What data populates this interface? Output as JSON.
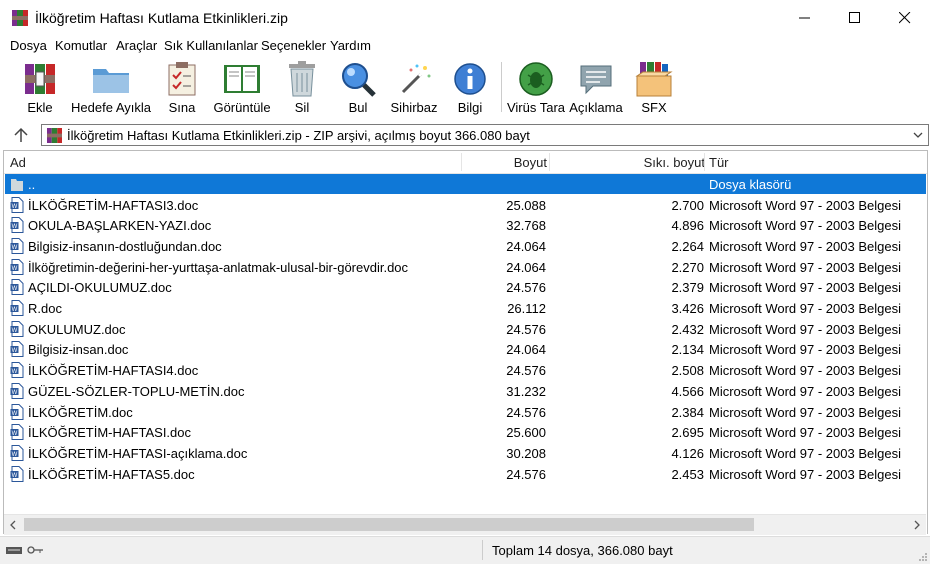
{
  "window": {
    "title": "İlköğretim Haftası Kutlama Etkinlikleri.zip",
    "minimize_glyph": "—",
    "maximize_glyph": "☐",
    "close_glyph": "✕"
  },
  "menu": [
    "Dosya",
    "Komutlar",
    "Araçlar",
    "Sık Kullanılanlar",
    "Seçenekler",
    "Yardım"
  ],
  "toolbar": [
    {
      "label": "Ekle",
      "icon": "books-add-icon"
    },
    {
      "label": "Hedefe Ayıkla",
      "icon": "folder-extract-icon"
    },
    {
      "label": "Sına",
      "icon": "test-checklist-icon"
    },
    {
      "label": "Görüntüle",
      "icon": "book-view-icon"
    },
    {
      "label": "Sil",
      "icon": "trash-icon"
    },
    {
      "label": "Bul",
      "icon": "magnifier-icon"
    },
    {
      "label": "Sihirbaz",
      "icon": "wizard-wand-icon"
    },
    {
      "label": "Bilgi",
      "icon": "info-icon"
    },
    {
      "label": "Virüs Tara",
      "icon": "virus-scan-icon"
    },
    {
      "label": "Açıklama",
      "icon": "comment-icon"
    },
    {
      "label": "SFX",
      "icon": "sfx-box-icon"
    }
  ],
  "address": {
    "text": "İlköğretim Haftası Kutlama Etkinlikleri.zip - ZIP arşivi, açılmış boyut 366.080 bayt"
  },
  "columns": {
    "name": "Ad",
    "size": "Boyut",
    "packed": "Sıkı. boyut",
    "type": "Tür"
  },
  "parent_row": {
    "name": "..",
    "type": "Dosya klasörü"
  },
  "files": [
    {
      "name": "İLKÖĞRETİM-HAFTASI3.doc",
      "size": "25.088",
      "packed": "2.700",
      "type": "Microsoft Word 97 - 2003 Belgesi"
    },
    {
      "name": "OKULA-BAŞLARKEN-YAZI.doc",
      "size": "32.768",
      "packed": "4.896",
      "type": "Microsoft Word 97 - 2003 Belgesi"
    },
    {
      "name": "Bilgisiz-insanın-dostluğundan.doc",
      "size": "24.064",
      "packed": "2.264",
      "type": "Microsoft Word 97 - 2003 Belgesi"
    },
    {
      "name": "İlköğretimin-değerini-her-yurttaşa-anlatmak-ulusal-bir-görevdir.doc",
      "size": "24.064",
      "packed": "2.270",
      "type": "Microsoft Word 97 - 2003 Belgesi"
    },
    {
      "name": "AÇILDI-OKULUMUZ.doc",
      "size": "24.576",
      "packed": "2.379",
      "type": "Microsoft Word 97 - 2003 Belgesi"
    },
    {
      "name": "R.doc",
      "size": "26.112",
      "packed": "3.426",
      "type": "Microsoft Word 97 - 2003 Belgesi"
    },
    {
      "name": "OKULUMUZ.doc",
      "size": "24.576",
      "packed": "2.432",
      "type": "Microsoft Word 97 - 2003 Belgesi"
    },
    {
      "name": "Bilgisiz-insan.doc",
      "size": "24.064",
      "packed": "2.134",
      "type": "Microsoft Word 97 - 2003 Belgesi"
    },
    {
      "name": "İLKÖĞRETİM-HAFTASI4.doc",
      "size": "24.576",
      "packed": "2.508",
      "type": "Microsoft Word 97 - 2003 Belgesi"
    },
    {
      "name": "GÜZEL-SÖZLER-TOPLU-METİN.doc",
      "size": "31.232",
      "packed": "4.566",
      "type": "Microsoft Word 97 - 2003 Belgesi"
    },
    {
      "name": "İLKÖĞRETİM.doc",
      "size": "24.576",
      "packed": "2.384",
      "type": "Microsoft Word 97 - 2003 Belgesi"
    },
    {
      "name": "İLKÖĞRETİM-HAFTASI.doc",
      "size": "25.600",
      "packed": "2.695",
      "type": "Microsoft Word 97 - 2003 Belgesi"
    },
    {
      "name": "İLKÖĞRETİM-HAFTASI-açıklama.doc",
      "size": "30.208",
      "packed": "4.126",
      "type": "Microsoft Word 97 - 2003 Belgesi"
    },
    {
      "name": "İLKÖĞRETİM-HAFTAS5.doc",
      "size": "24.576",
      "packed": "2.453",
      "type": "Microsoft Word 97 - 2003 Belgesi"
    }
  ],
  "status": {
    "text": "Toplam 14 dosya, 366.080 bayt"
  },
  "colors": {
    "selection": "#0f78d7",
    "selection_text": "#ffffff"
  }
}
